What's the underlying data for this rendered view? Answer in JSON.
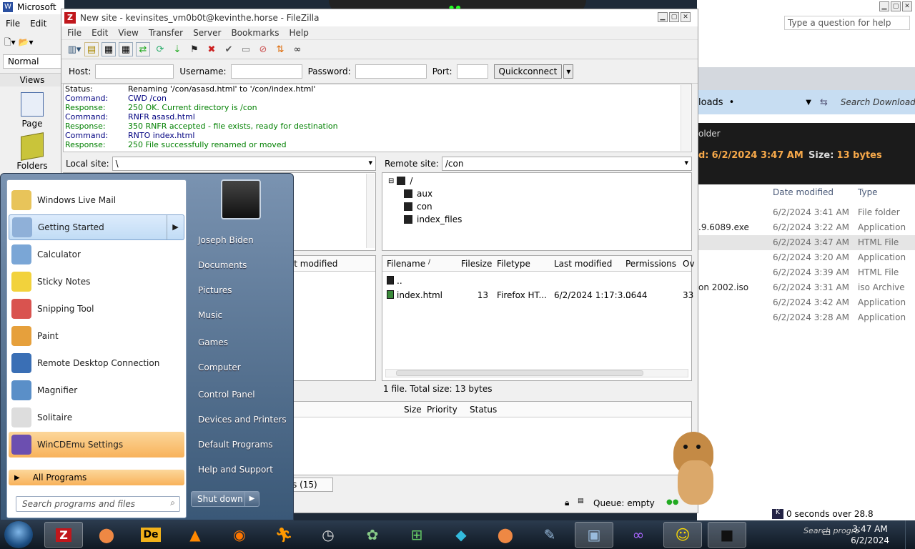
{
  "word": {
    "title": "Microsoft",
    "menu": [
      "File",
      "Edit"
    ],
    "style": "Normal",
    "views_label": "Views",
    "view_items": [
      "Page",
      "Folders"
    ]
  },
  "downloads": {
    "help_placeholder": "Type a question for help",
    "nav_title": "loads",
    "search": "Search Download",
    "folder_text": "older",
    "date_prefix": "d:",
    "date_value": "6/2/2024 3:47 AM",
    "size_label": "Size:",
    "size_value": "13 bytes",
    "col_date": "Date modified",
    "col_type": "Type",
    "rows": [
      {
        "name": "",
        "date": "6/2/2024 3:41 AM",
        "type": "File folder"
      },
      {
        "name": ".9.6089.exe",
        "date": "6/2/2024 3:22 AM",
        "type": "Application"
      },
      {
        "name": "",
        "date": "6/2/2024 3:47 AM",
        "type": "HTML File"
      },
      {
        "name": "",
        "date": "6/2/2024 3:20 AM",
        "type": "Application"
      },
      {
        "name": "",
        "date": "6/2/2024 3:39 AM",
        "type": "HTML File"
      },
      {
        "name": "on 2002.iso",
        "date": "6/2/2024 3:31 AM",
        "type": "iso Archive"
      },
      {
        "name": "",
        "date": "6/2/2024 3:42 AM",
        "type": "Application"
      },
      {
        "name": "",
        "date": "6/2/2024 3:28 AM",
        "type": "Application"
      }
    ]
  },
  "filezilla": {
    "title": "New site - kevinsites_vm0b0t@kevinthe.horse - FileZilla",
    "menu": [
      "File",
      "Edit",
      "View",
      "Transfer",
      "Server",
      "Bookmarks",
      "Help"
    ],
    "qc": {
      "host_label": "Host:",
      "user_label": "Username:",
      "pass_label": "Password:",
      "port_label": "Port:",
      "button": "Quickconnect"
    },
    "log": [
      {
        "k": "Status:",
        "v": "Renaming '/con/asasd.html' to '/con/index.html'",
        "kind": "status"
      },
      {
        "k": "Command:",
        "v": "CWD /con",
        "kind": "cmd"
      },
      {
        "k": "Response:",
        "v": "250 OK. Current directory is /con",
        "kind": "resp"
      },
      {
        "k": "Command:",
        "v": "RNFR asasd.html",
        "kind": "cmd"
      },
      {
        "k": "Response:",
        "v": "350 RNFR accepted - file exists, ready for destination",
        "kind": "resp"
      },
      {
        "k": "Command:",
        "v": "RNTO index.html",
        "kind": "cmd"
      },
      {
        "k": "Response:",
        "v": "250 File successfully renamed or moved",
        "kind": "resp"
      }
    ],
    "local_label": "Local site:",
    "local_path": "\\",
    "remote_label": "Remote site:",
    "remote_path": "/con",
    "tree": [
      "/",
      "aux",
      "con",
      "index_files"
    ],
    "local_col_modified": "st modified",
    "remote_cols": [
      "Filename",
      "Filesize",
      "Filetype",
      "Last modified",
      "Permissions",
      "Ov"
    ],
    "remote_files": [
      {
        "name": "..",
        "size": "",
        "type": "",
        "modified": "",
        "perm": "",
        "owner": ""
      },
      {
        "name": "index.html",
        "size": "13",
        "type": "Firefox HT...",
        "modified": "6/2/2024 1:17:3...",
        "perm": "0644",
        "owner": "33"
      }
    ],
    "remote_status": "1 file. Total size: 13 bytes",
    "queue_cols": [
      "Size",
      "Priority",
      "Status"
    ],
    "queue_tab": "s (15)",
    "queue_status": "Queue: empty"
  },
  "start_menu": {
    "items": [
      {
        "label": "Windows Live Mail",
        "color": "#e8c45a"
      },
      {
        "label": "Getting Started",
        "color": "#8fb0d8"
      },
      {
        "label": "Calculator",
        "color": "#7aa6d6"
      },
      {
        "label": "Sticky Notes",
        "color": "#f2d23c"
      },
      {
        "label": "Snipping Tool",
        "color": "#d9534f"
      },
      {
        "label": "Paint",
        "color": "#e6a03c"
      },
      {
        "label": "Remote Desktop Connection",
        "color": "#3a6fb5"
      },
      {
        "label": "Magnifier",
        "color": "#5a8fc8"
      },
      {
        "label": "Solitaire",
        "color": "#ddd"
      },
      {
        "label": "WinCDEmu Settings",
        "color": "#6c4fb0"
      }
    ],
    "all_programs": "All Programs",
    "search_placeholder": "Search programs and files",
    "right": [
      "Joseph Biden",
      "Documents",
      "Pictures",
      "Music",
      "Games",
      "Computer",
      "Control Panel",
      "Devices and Printers",
      "Default Programs",
      "Help and Support"
    ],
    "shutdown": "Shut down"
  },
  "taskbar": {
    "time": "3:47 AM",
    "date": "6/2/2024",
    "tray_search": "Search progra",
    "hint": "0 seconds over 28.8"
  }
}
